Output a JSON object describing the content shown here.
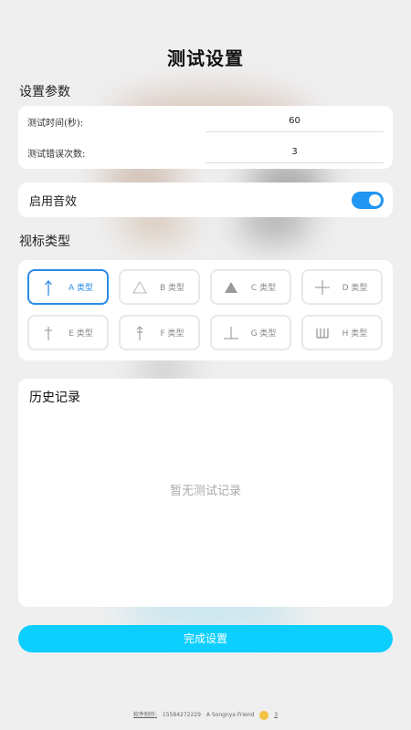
{
  "header": {
    "title": "测试设置"
  },
  "params": {
    "section_label": "设置参数",
    "rows": [
      {
        "label": "测试时间(秒):",
        "value": "60"
      },
      {
        "label": "测试错误次数:",
        "value": "3"
      }
    ]
  },
  "sound": {
    "label": "启用音效",
    "enabled": true
  },
  "types": {
    "section_label": "视标类型",
    "items": [
      {
        "label": "A 类型",
        "icon": "arrow-up-icon",
        "active": true
      },
      {
        "label": "B 类型",
        "icon": "triangle-outline-icon",
        "active": false
      },
      {
        "label": "C 类型",
        "icon": "triangle-filled-icon",
        "active": false
      },
      {
        "label": "D 类型",
        "icon": "cross-icon",
        "active": false
      },
      {
        "label": "E 类型",
        "icon": "dagger-icon",
        "active": false
      },
      {
        "label": "F 类型",
        "icon": "arrow-cross-icon",
        "active": false
      },
      {
        "label": "G 类型",
        "icon": "inverted-t-icon",
        "active": false
      },
      {
        "label": "H 类型",
        "icon": "comb-icon",
        "active": false
      }
    ]
  },
  "history": {
    "title": "历史记录",
    "empty_text": "暂无测试记录"
  },
  "finish": {
    "label": "完成设置"
  },
  "footer": {
    "prefix": "软件制作:",
    "phone": "15584272229",
    "suffix": "A Songnya Friend",
    "tail": "3"
  },
  "colors": {
    "accent": "#2196f3",
    "finish": "#0ccfff"
  }
}
